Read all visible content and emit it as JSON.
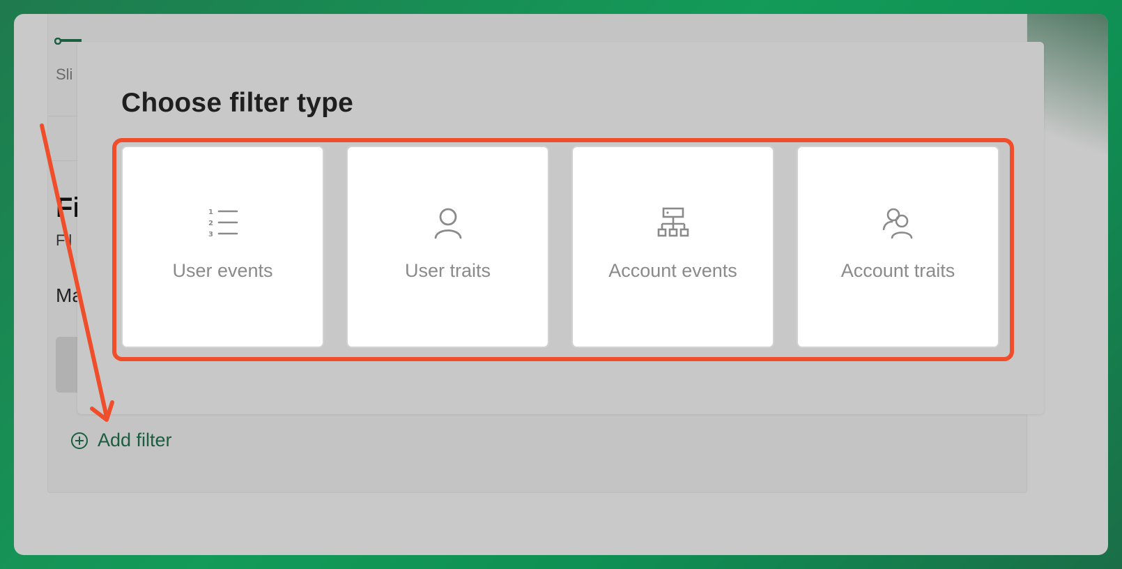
{
  "background_page": {
    "subtitle_partial": "Sli",
    "heading_partial": "Fi",
    "description_partial": "Fil",
    "label_partial": "Ma",
    "add_filter_label": "Add filter"
  },
  "modal": {
    "title": "Choose filter type",
    "options": [
      {
        "label": "User events",
        "icon": "numbered-list-icon"
      },
      {
        "label": "User traits",
        "icon": "user-icon"
      },
      {
        "label": "Account events",
        "icon": "org-hierarchy-icon"
      },
      {
        "label": "Account traits",
        "icon": "users-group-icon"
      }
    ]
  },
  "colors": {
    "annotation_red": "#f04e2a",
    "brand_green": "#1b5e3f",
    "icon_gray": "#8a8a8a"
  }
}
